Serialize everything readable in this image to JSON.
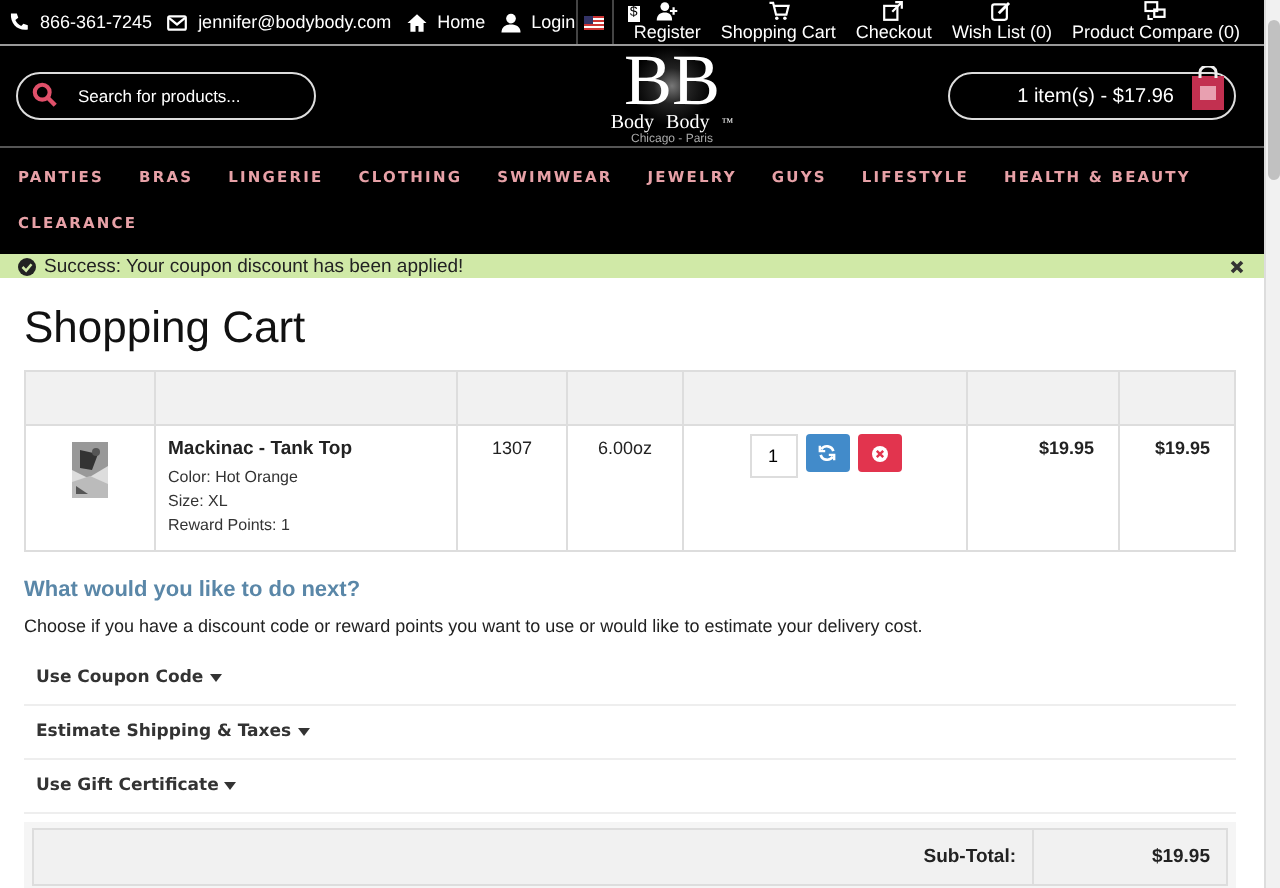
{
  "top_bar": {
    "phone": "866-361-7245",
    "email": "jennifer@bodybody.com",
    "links": [
      {
        "label": "Home"
      },
      {
        "label": "Login"
      }
    ],
    "currency": "$",
    "account_links": [
      {
        "label": "Register"
      },
      {
        "label": "Shopping Cart"
      },
      {
        "label": "Checkout"
      },
      {
        "label": "Wish List (0)"
      },
      {
        "label": "Product Compare (0)"
      }
    ]
  },
  "header": {
    "search": {
      "placeholder": "Search for products..."
    },
    "logo": {
      "letters": [
        "B",
        "B"
      ],
      "words": [
        "Body",
        "Body"
      ],
      "trademark": "™",
      "tagline": "Chicago - Paris"
    },
    "cart_button": "1 item(s) - $17.96"
  },
  "nav": {
    "items": [
      "PANTIES",
      "BRAS",
      "LINGERIE",
      "CLOTHING",
      "SWIMWEAR",
      "JEWELRY",
      "GUYS",
      "LIFESTYLE",
      "HEALTH & BEAUTY",
      "CLEARANCE"
    ]
  },
  "alert": {
    "message": "Success: Your coupon discount has been applied!"
  },
  "page_title": "Shopping Cart",
  "cart_table": {
    "rows": [
      {
        "name": "Mackinac - Tank Top",
        "options": [
          "Color: Hot Orange",
          "Size: XL",
          "Reward Points: 1"
        ],
        "model": "1307",
        "weight": "6.00oz",
        "quantity": "1",
        "unit_price": "$19.95",
        "total": "$19.95"
      }
    ]
  },
  "next_steps": {
    "heading": "What would you like to do next?",
    "text": "Choose if you have a discount code or reward points you want to use or would like to estimate your delivery cost.",
    "panels": [
      {
        "label": "Use Coupon Code",
        "expanded": false
      },
      {
        "label": "Estimate Shipping & Taxes",
        "expanded": false
      },
      {
        "label": "Use Gift Certificate",
        "expanded": false
      }
    ]
  },
  "totals": [
    {
      "label": "Sub-Total:",
      "value": "$19.95"
    }
  ]
}
